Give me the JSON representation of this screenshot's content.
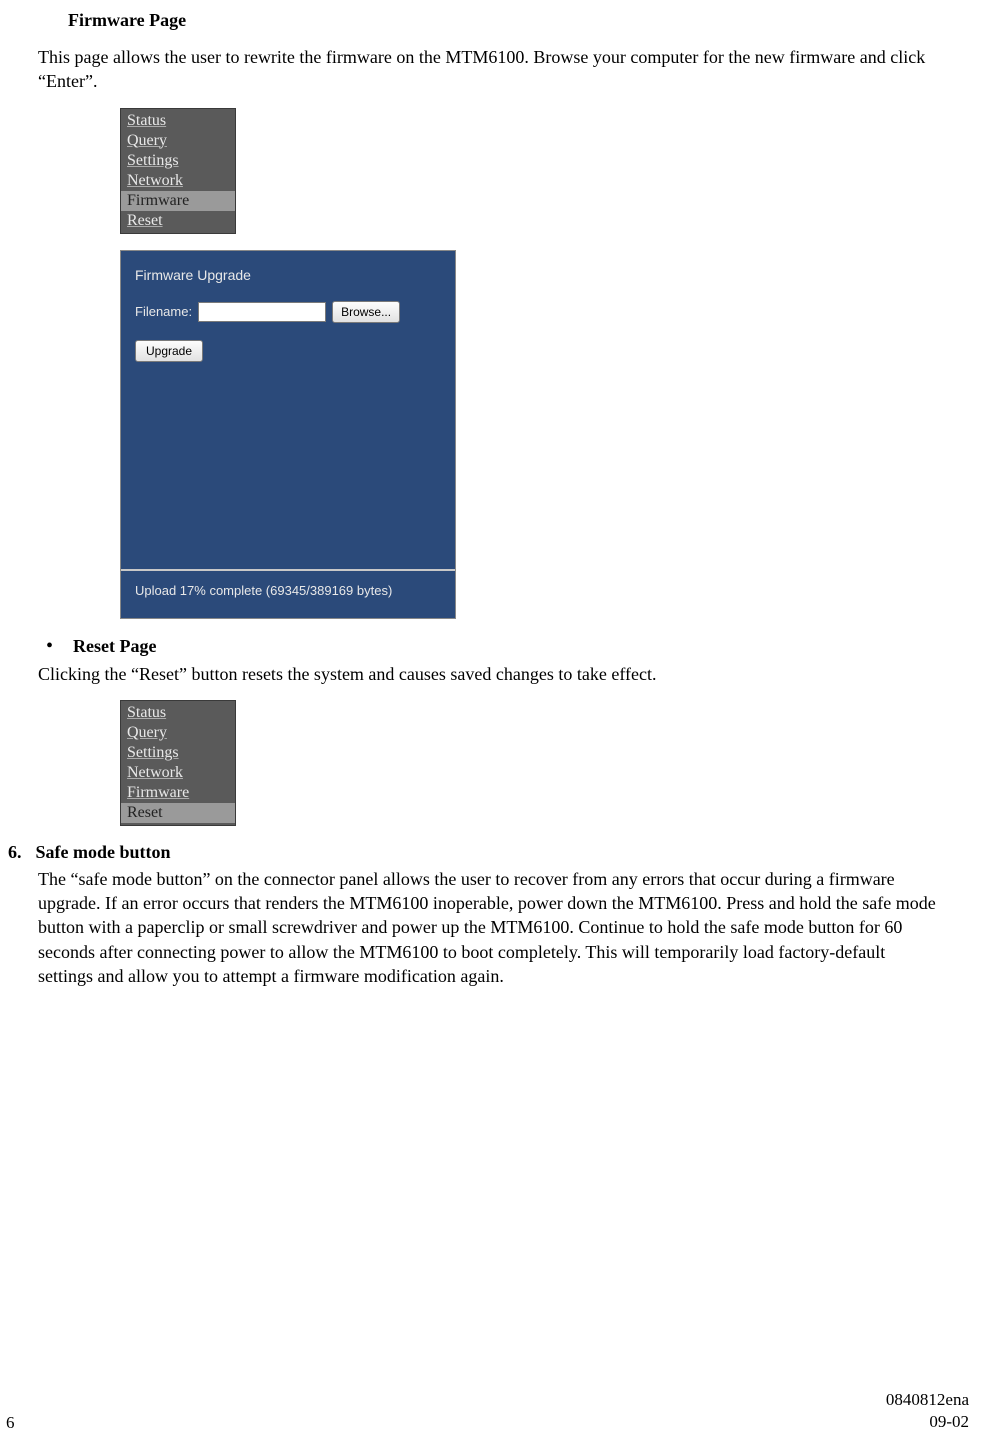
{
  "firmware": {
    "heading": "Firmware Page",
    "body": "This page allows the user to rewrite the firmware on the MTM6100. Browse your computer for the new firmware and click “Enter”.",
    "nav": {
      "items": [
        "Status",
        "Query",
        "Settings",
        "Network",
        "Firmware",
        "Reset"
      ],
      "selected": "Firmware"
    },
    "panel": {
      "title": "Firmware Upgrade",
      "filename_label": "Filename:",
      "filename_value": "",
      "browse_label": "Browse...",
      "upgrade_label": "Upgrade",
      "status": "Upload 17% complete (69345/389169 bytes)"
    }
  },
  "reset": {
    "bullet_label": "Reset Page",
    "body": "Clicking the “Reset” button resets the system and causes saved changes to take effect.",
    "nav": {
      "items": [
        "Status",
        "Query",
        "Settings",
        "Network",
        "Firmware",
        "Reset"
      ],
      "selected": "Reset"
    }
  },
  "safemode": {
    "number": "6.",
    "label": "Safe mode button",
    "body": "The “safe mode button” on the connector panel allows the user to recover from any errors that occur during a firmware upgrade. If an error occurs that renders the MTM6100 inoperable, power down the MTM6100. Press and hold the safe mode button with a paperclip or small screwdriver and power up the MTM6100. Continue to hold the safe mode button for 60 seconds after connecting power to allow the MTM6100 to boot completely. This will temporarily load factory-default settings and allow you to attempt a firmware modification again."
  },
  "footer": {
    "page": "6",
    "doc_id": "0840812ena",
    "rev": "09-02"
  }
}
